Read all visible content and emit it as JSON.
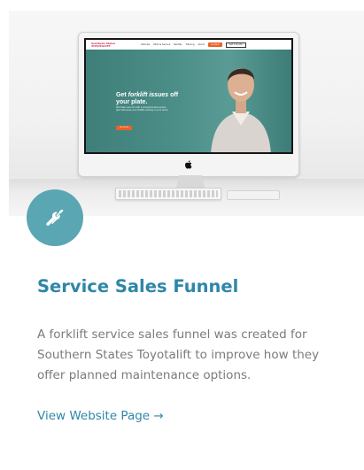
{
  "card": {
    "title": "Service Sales Funnel",
    "description": "A forklift service sales funnel was created for Southern States Toyotalift to improve how they offer planned maintenance options.",
    "link_label": "View Website Page",
    "link_arrow": "→",
    "icon": "tools-icon"
  },
  "mockup": {
    "logo_line1": "Southern States",
    "logo_line2": "TOYOTALIFT",
    "menu": [
      "Vehicles",
      "Parts & Service",
      "Rentals",
      "Training",
      "About"
    ],
    "cta": "Contact",
    "outline_button": "Get a Quote",
    "headline_prefix": "Get ",
    "headline_emphasis": "forklift issues",
    "headline_suffix": " off your plate.",
    "subtext": "We'll take care of it with a comprehensive service plan that keeps your forklifts working on your terms.",
    "button": "Get Started"
  },
  "colors": {
    "accent": "#2f86a8",
    "badge": "#5aa6b3",
    "body_text": "#7b7b7b",
    "site_teal": "#4c8e88",
    "site_orange": "#e9612b"
  }
}
